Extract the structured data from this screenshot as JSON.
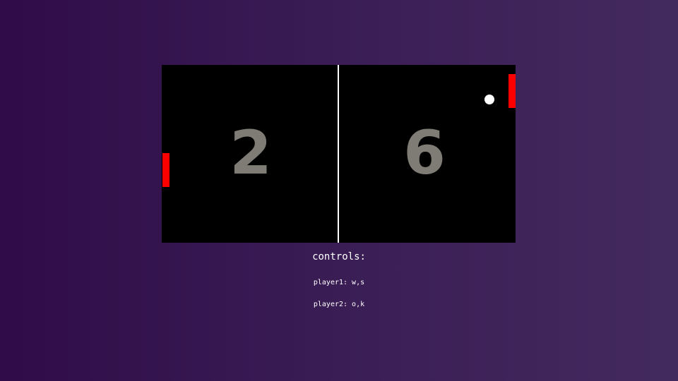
{
  "game": {
    "score_left": "2",
    "score_right": "6",
    "paddle_color": "#ff0000",
    "ball_color": "#ffffff",
    "background_color": "#000000"
  },
  "controls": {
    "title": "controls:",
    "player1": "player1: w,s",
    "player2": "player2: o,k"
  }
}
